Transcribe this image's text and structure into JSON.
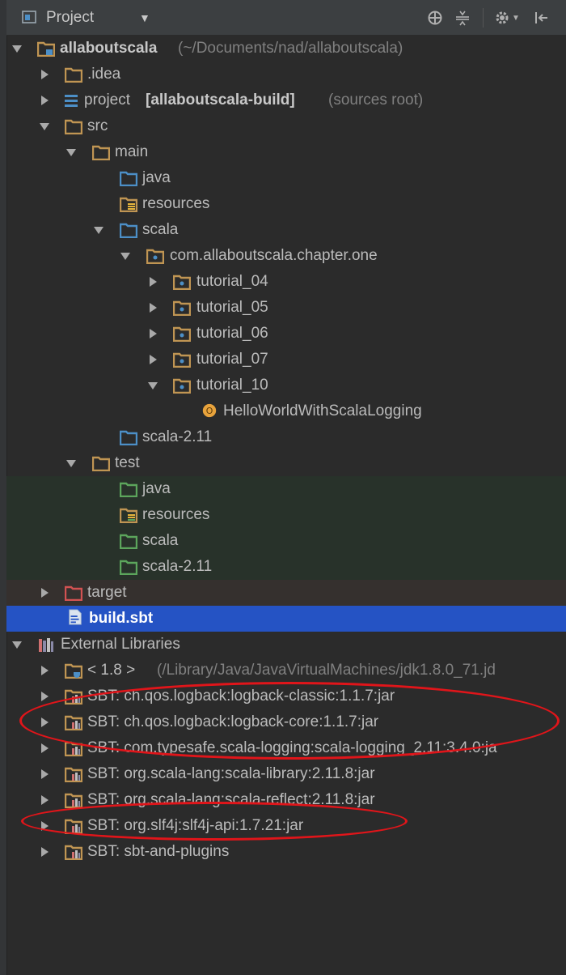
{
  "panel": {
    "title": "Project"
  },
  "toolbar": {
    "locate_icon": "crosshair-icon",
    "collapse_icon": "collapse-all-icon",
    "settings_icon": "gear-icon",
    "hide_icon": "hide-panel-icon"
  },
  "tree": {
    "root": {
      "name": "allaboutscala",
      "path": "(~/Documents/nad/allaboutscala)"
    },
    "idea": ".idea",
    "project": {
      "name": "project",
      "module": "[allaboutscala-build]",
      "note": "(sources root)"
    },
    "src": "src",
    "main": "main",
    "main_java": "java",
    "main_resources": "resources",
    "main_scala": "scala",
    "package": "com.allaboutscala.chapter.one",
    "tutorial_04": "tutorial_04",
    "tutorial_05": "tutorial_05",
    "tutorial_06": "tutorial_06",
    "tutorial_07": "tutorial_07",
    "tutorial_10": "tutorial_10",
    "hello": "HelloWorldWithScalaLogging",
    "main_scala_211": "scala-2.11",
    "test": "test",
    "test_java": "java",
    "test_resources": "resources",
    "test_scala": "scala",
    "test_scala_211": "scala-2.11",
    "target": "target",
    "build_sbt": "build.sbt",
    "external": "External Libraries",
    "jdk": {
      "name": "< 1.8 >",
      "path": "(/Library/Java/JavaVirtualMachines/jdk1.8.0_71.jd"
    },
    "libs": [
      "SBT: ch.qos.logback:logback-classic:1.1.7:jar",
      "SBT: ch.qos.logback:logback-core:1.1.7:jar",
      "SBT: com.typesafe.scala-logging:scala-logging_2.11:3.4.0:ja",
      "SBT: org.scala-lang:scala-library:2.11.8:jar",
      "SBT: org.scala-lang:scala-reflect:2.11.8:jar",
      "SBT: org.slf4j:slf4j-api:1.7.21:jar",
      "SBT: sbt-and-plugins"
    ]
  },
  "colors": {
    "background": "#2b2b2b",
    "selection": "#2553c4",
    "folder": "#c09553",
    "source_folder": "#4c8fc7",
    "test_folder": "#5ca55c",
    "excluded_folder": "#d25252",
    "annotation": "#e0151a"
  }
}
